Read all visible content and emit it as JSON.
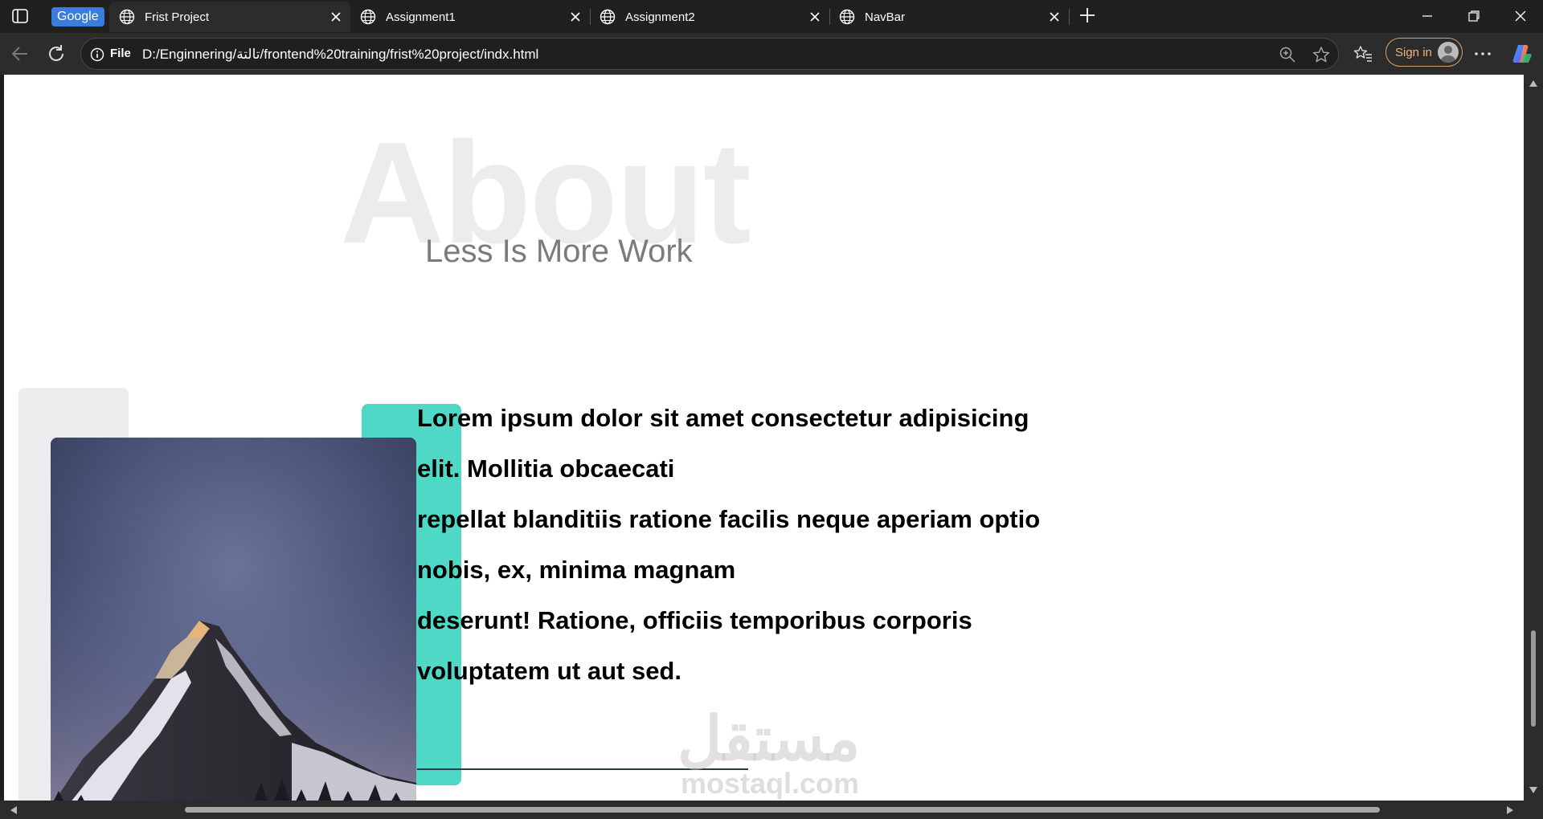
{
  "browser": {
    "tab_badge": "Google",
    "tabs": [
      {
        "title": "Frist Project",
        "active": true
      },
      {
        "title": "Assignment1",
        "active": false
      },
      {
        "title": "Assignment2",
        "active": false
      },
      {
        "title": "NavBar",
        "active": false
      }
    ],
    "address": {
      "scheme_label": "File",
      "url": "D:/Enginnering/تالتة/frontend%20training/frist%20project/indx.html"
    },
    "sign_in_label": "Sign in"
  },
  "page": {
    "background_heading": "About",
    "subheading": "Less Is More Work",
    "paragraph": "Lorem ipsum dolor sit amet consectetur adipisicing\nelit. Mollitia obcaecati\nrepellat blanditiis ratione facilis neque aperiam optio\nnobis, ex, minima magnam\ndeserunt! Ratione, officiis temporibus corporis\nvoluptatem ut aut sed.",
    "accent_color": "#4fd8c5",
    "panel_color": "#ececef",
    "image_subject": "snowy-mountain-peak"
  },
  "watermark": {
    "arabic": "مستقل",
    "latin": "mostaql.com"
  }
}
